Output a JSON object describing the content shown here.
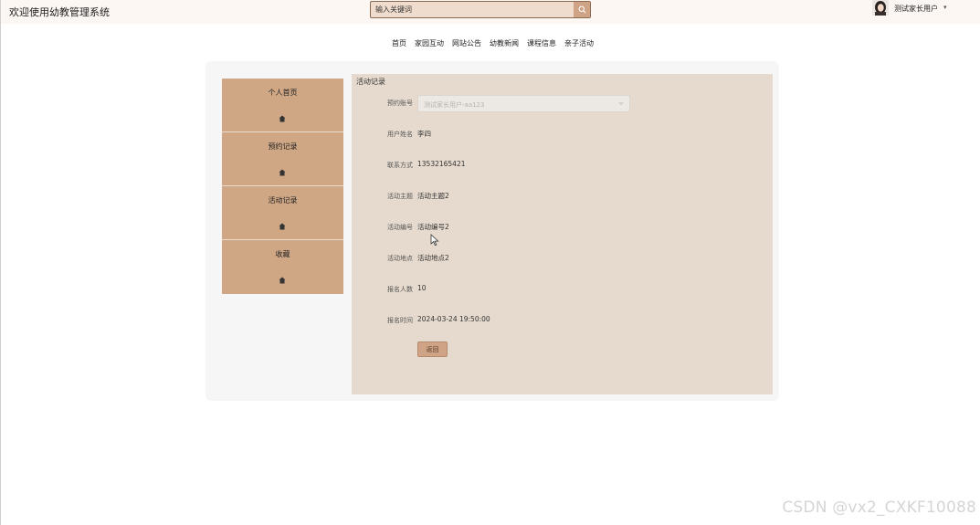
{
  "header": {
    "site_title": "欢迎使用幼教管理系统",
    "search_placeholder": "输入关键词",
    "user_name": "测试家长用户",
    "user_caret": "▾"
  },
  "nav": {
    "items": [
      "首页",
      "家园互动",
      "网站公告",
      "幼教新闻",
      "课程信息",
      "亲子活动"
    ]
  },
  "sidebar": {
    "items": [
      {
        "label": "个人首页"
      },
      {
        "label": "预约记录"
      },
      {
        "label": "活动记录"
      },
      {
        "label": "收藏"
      }
    ]
  },
  "panel": {
    "title": "活动记录",
    "fields": {
      "account": {
        "label": "预约账号",
        "value": "测试家长用户-aa123"
      },
      "user_name": {
        "label": "用户姓名",
        "value": "李四"
      },
      "phone": {
        "label": "联系方式",
        "value": "13532165421"
      },
      "activity_theme": {
        "label": "活动主题",
        "value": "活动主题2"
      },
      "activity_no": {
        "label": "活动编号",
        "value": "活动编号2"
      },
      "activity_place": {
        "label": "活动地点",
        "value": "活动地点2"
      },
      "signup_count": {
        "label": "报名人数",
        "value": "10"
      },
      "signup_time": {
        "label": "报名时间",
        "value": "2024-03-24 19:50:00"
      }
    },
    "back_label": "返回"
  },
  "watermark": "CSDN @vx2_CXKF10088",
  "colors": {
    "accent": "#cfa486",
    "sidebar_bg": "#cfa785",
    "panel_bg": "#e5dacd",
    "header_bg": "#fdf7f3"
  },
  "icons": {
    "search": "search-icon",
    "side": "home-icon",
    "select": "chevron-down-icon"
  }
}
